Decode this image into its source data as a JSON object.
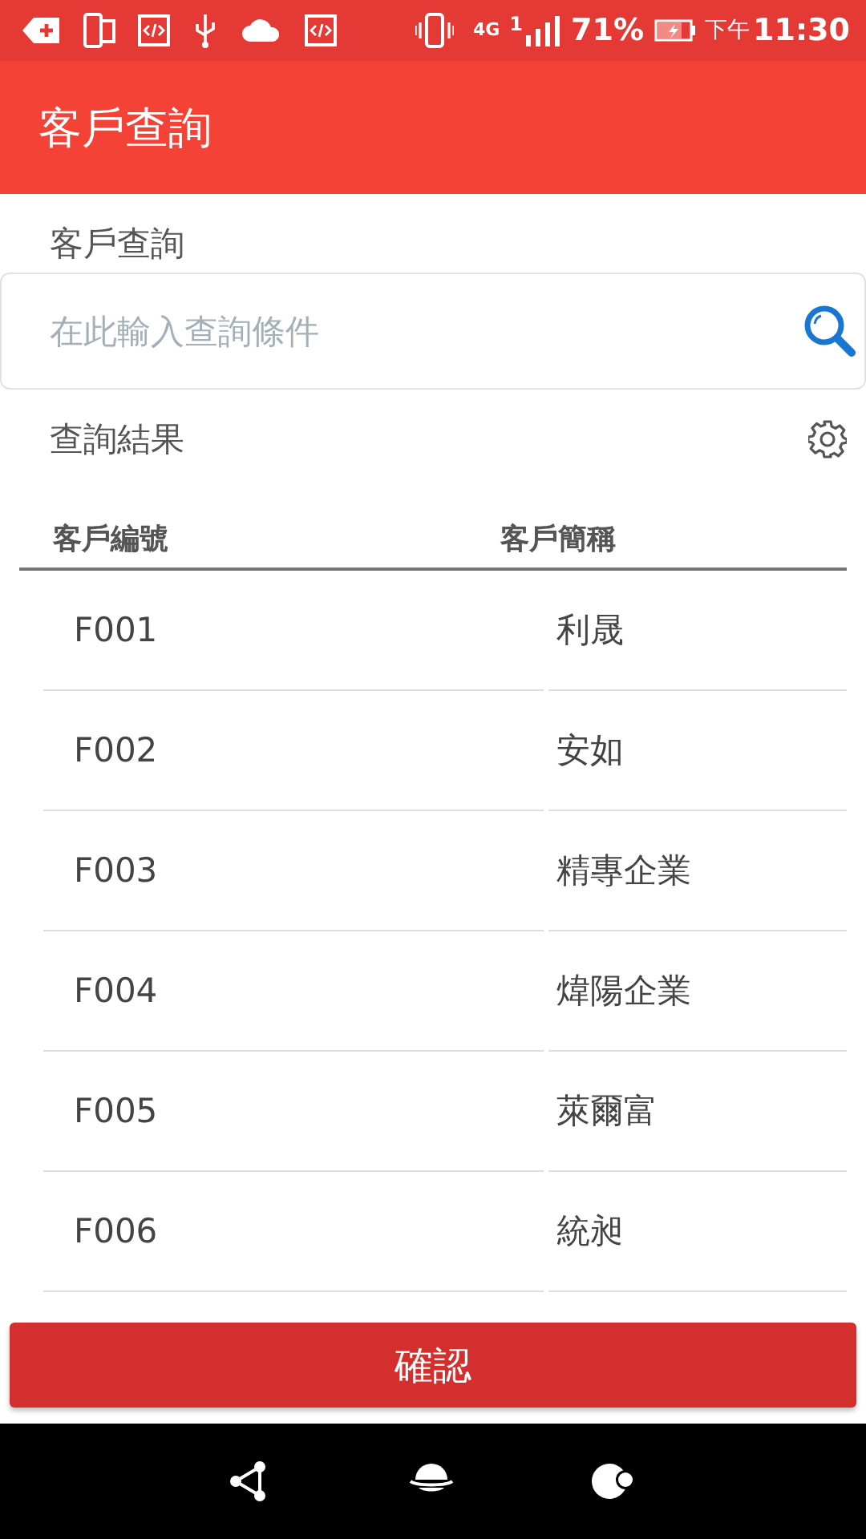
{
  "status_bar": {
    "network": "4G",
    "sim": "1",
    "battery": "71%",
    "ampm": "下午",
    "time": "11:30"
  },
  "app_bar": {
    "title": "客戶查詢"
  },
  "search_section": {
    "label": "客戶查詢",
    "placeholder": "在此輸入查詢條件"
  },
  "results": {
    "title": "查詢結果",
    "table": {
      "columns": [
        "客戶編號",
        "客戶簡稱"
      ],
      "rows": [
        {
          "cells": [
            "F001",
            "利晟"
          ]
        },
        {
          "cells": [
            "F002",
            "安如"
          ]
        },
        {
          "cells": [
            "F003",
            "精專企業"
          ]
        },
        {
          "cells": [
            "F004",
            "煒陽企業"
          ]
        },
        {
          "cells": [
            "F005",
            "萊爾富"
          ]
        },
        {
          "cells": [
            "F006",
            "統昶"
          ]
        }
      ]
    }
  },
  "confirm_button": "確認"
}
